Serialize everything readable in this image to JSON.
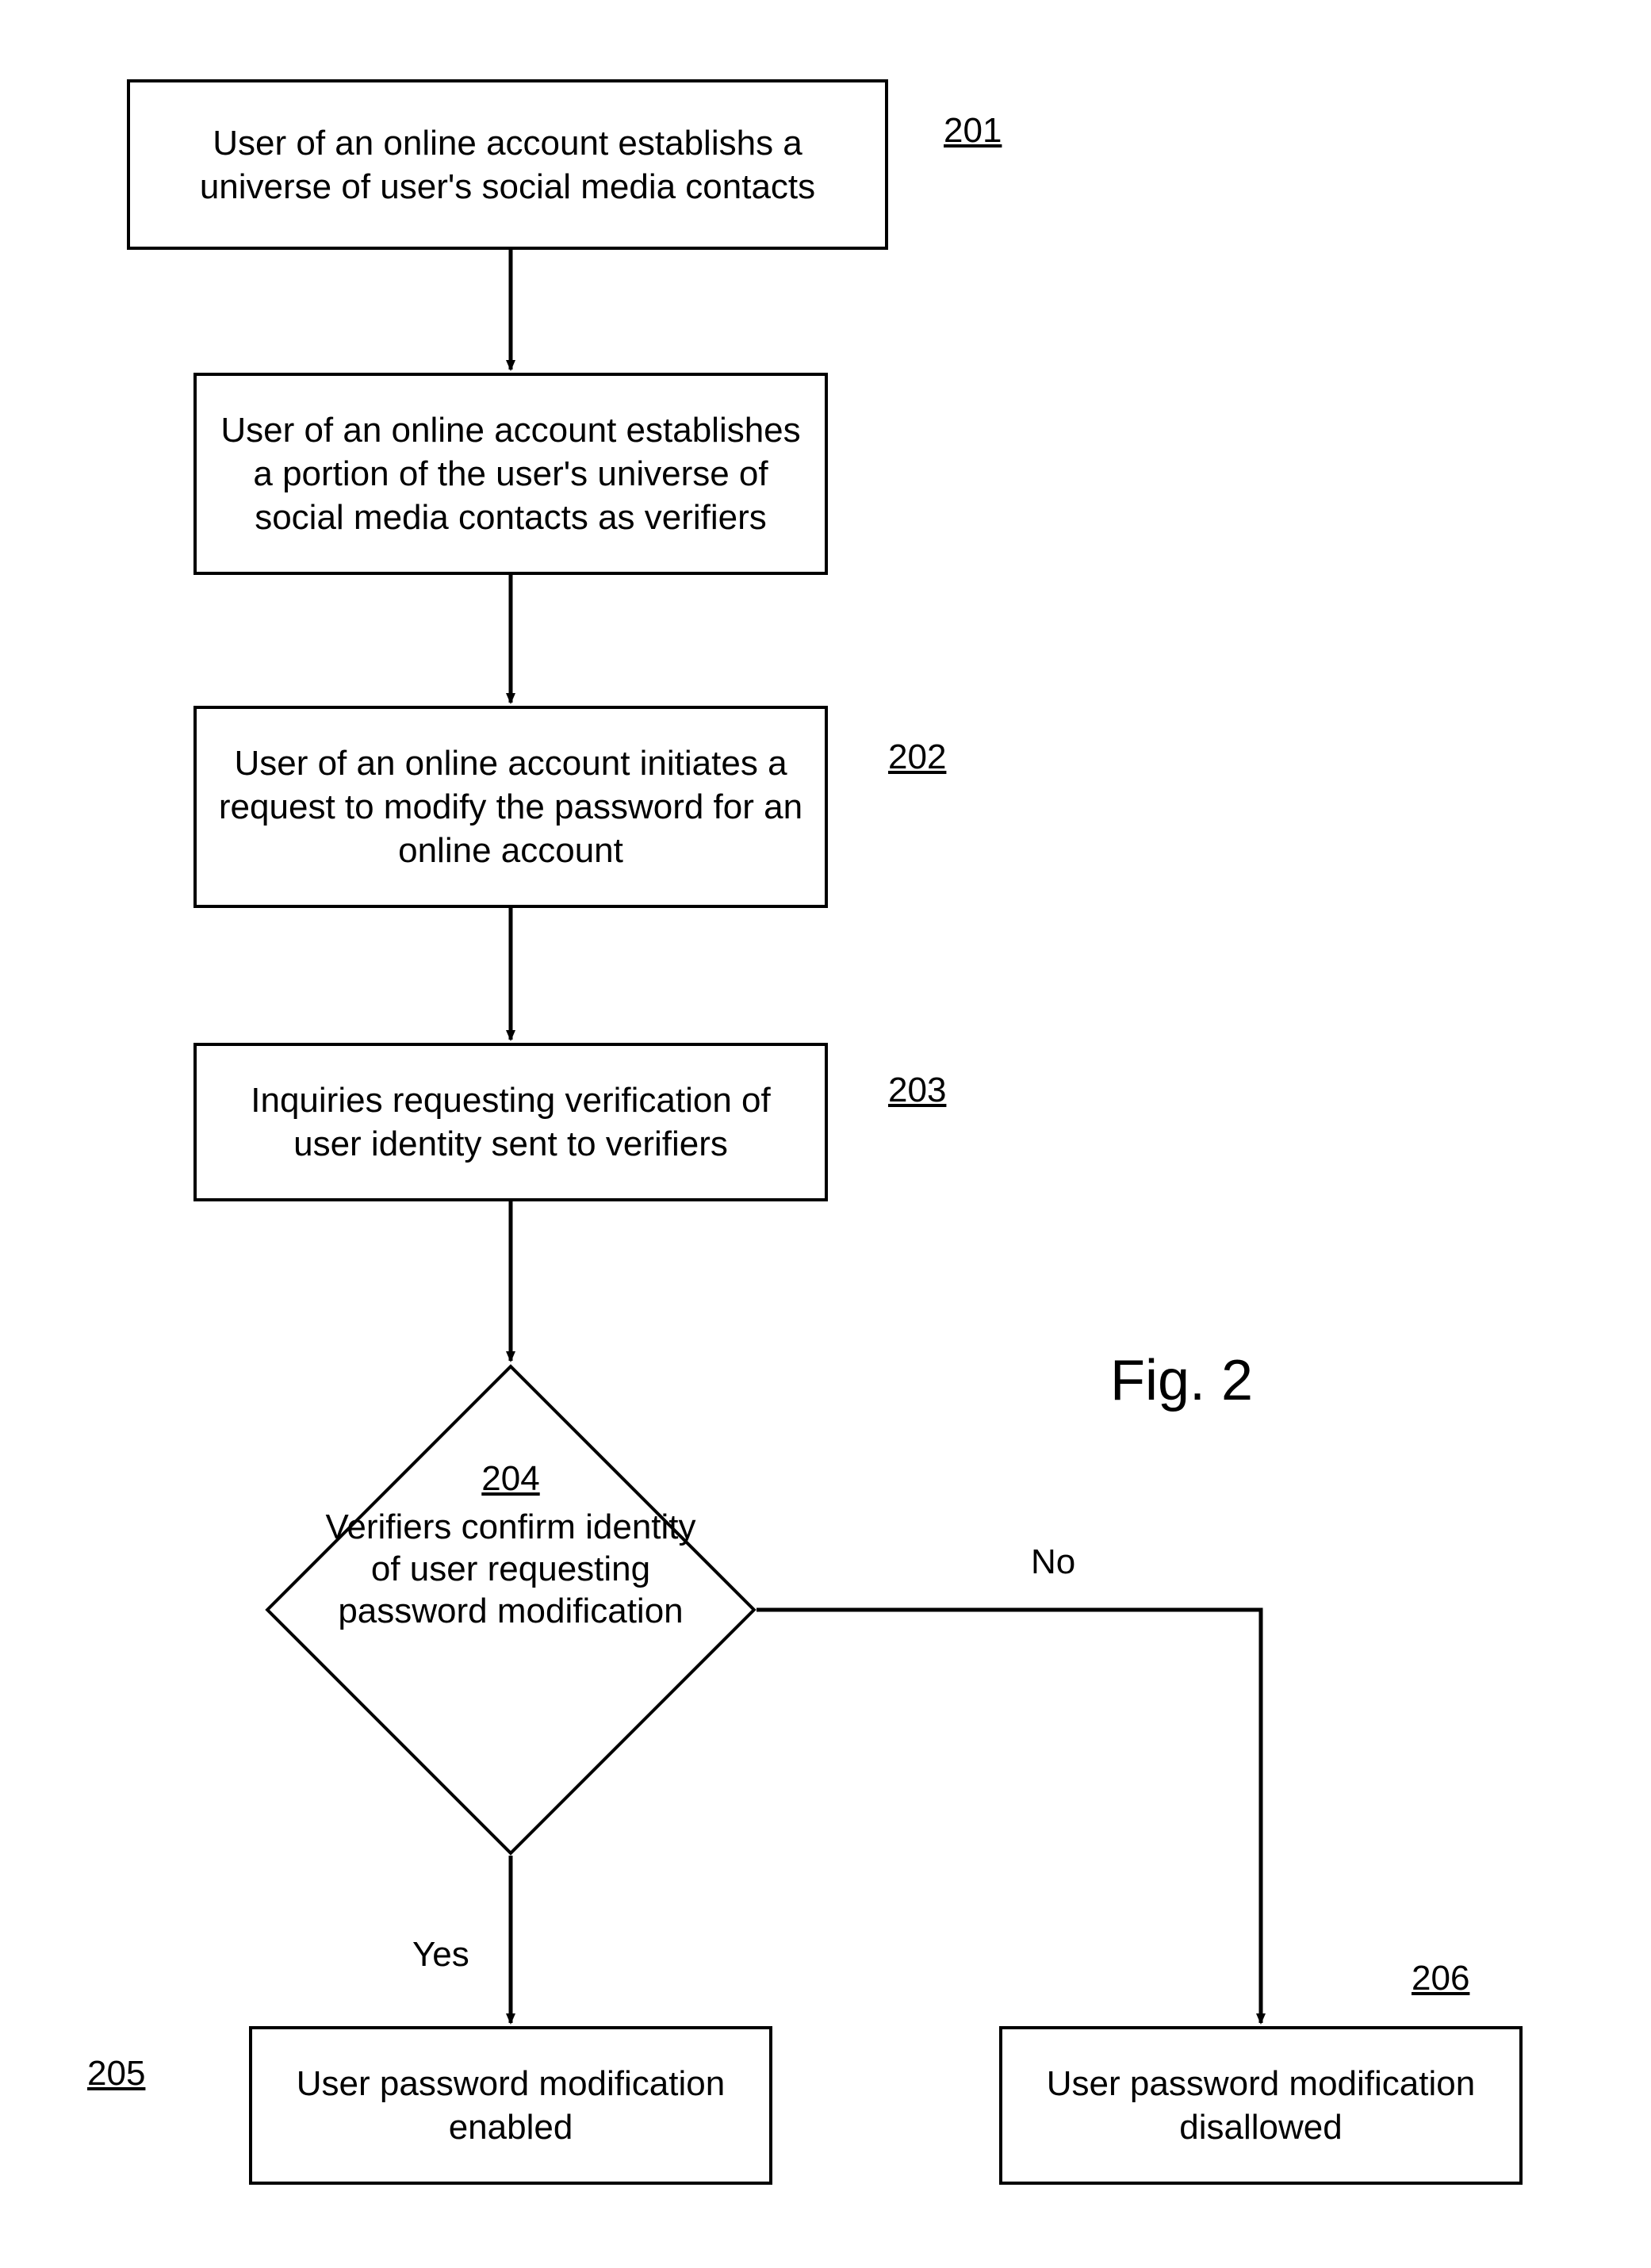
{
  "chart_data": {
    "type": "flowchart",
    "title": "Fig. 2",
    "nodes": [
      {
        "id": "201",
        "shape": "rect",
        "text": "User of an online account establishs a universe of user's social media contacts"
      },
      {
        "id": "201b",
        "shape": "rect",
        "text": "User of an online account establishes a portion of the user's universe of social media contacts as verifiers"
      },
      {
        "id": "202",
        "shape": "rect",
        "text": "User of an online account initiates a request to modify the password for an online account"
      },
      {
        "id": "203",
        "shape": "rect",
        "text": "Inquiries requesting verification of user identity sent to verifiers"
      },
      {
        "id": "204",
        "shape": "diamond",
        "text": "Verifiers confirm identity of user requesting password modification"
      },
      {
        "id": "205",
        "shape": "rect",
        "text": "User password modification enabled"
      },
      {
        "id": "206",
        "shape": "rect",
        "text": "User password modification disallowed"
      }
    ],
    "edges": [
      {
        "from": "201",
        "to": "201b",
        "label": ""
      },
      {
        "from": "201b",
        "to": "202",
        "label": ""
      },
      {
        "from": "202",
        "to": "203",
        "label": ""
      },
      {
        "from": "203",
        "to": "204",
        "label": ""
      },
      {
        "from": "204",
        "to": "205",
        "label": "Yes"
      },
      {
        "from": "204",
        "to": "206",
        "label": "No"
      }
    ]
  },
  "figure_label": "Fig. 2",
  "refs": {
    "r201": "201",
    "r202": "202",
    "r203": "203",
    "r204": "204",
    "r205": "205",
    "r206": "206"
  },
  "boxes": {
    "b201": "User of an online account establishs a universe of user's social media contacts",
    "b201b": "User of an online account establishes a portion of the user's universe of social media contacts as verifiers",
    "b202": "User of an online account initiates a request to modify the password for an online account",
    "b203": "Inquiries requesting verification of user identity sent to verifiers",
    "b204": "Verifiers confirm identity of user requesting password modification",
    "b205": "User password modification enabled",
    "b206": "User password modification disallowed"
  },
  "labels": {
    "yes": "Yes",
    "no": "No"
  }
}
